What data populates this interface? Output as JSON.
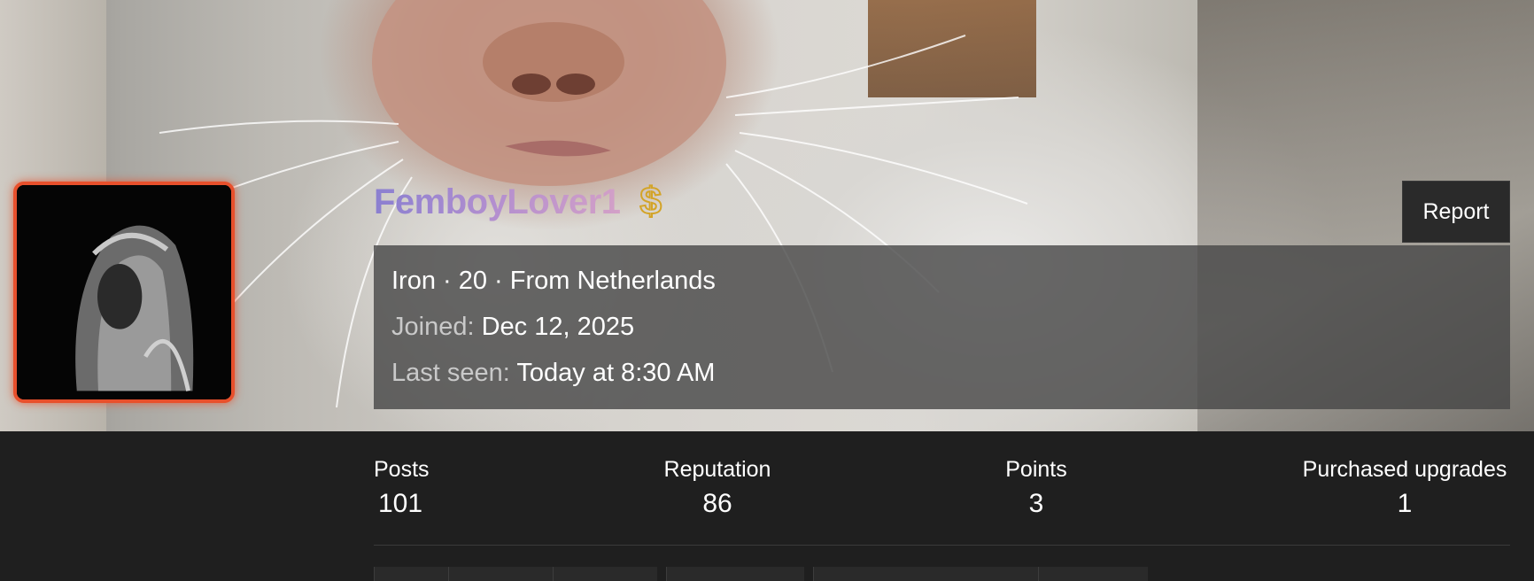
{
  "profile": {
    "username": "FemboyLover1",
    "badge_icon": "dollar-icon",
    "badge_glyph": "$",
    "report_label": "Report",
    "info": {
      "summary": "Iron · 20 · From Netherlands",
      "joined_label": "Joined:",
      "joined_value": "Dec 12, 2025",
      "last_seen_label": "Last seen:",
      "last_seen_value": "Today at 8:30 AM"
    }
  },
  "stats": [
    {
      "label": "Posts",
      "value": "101"
    },
    {
      "label": "Reputation",
      "value": "86"
    },
    {
      "label": "Points",
      "value": "3"
    },
    {
      "label": "Purchased upgrades",
      "value": "1"
    }
  ],
  "colors": {
    "avatar_border": "#e8502c",
    "badge": "#d3a428",
    "username_gradient": [
      "#8a7fd0",
      "#d3a0c7"
    ],
    "page_background": "#1f1f1f"
  }
}
